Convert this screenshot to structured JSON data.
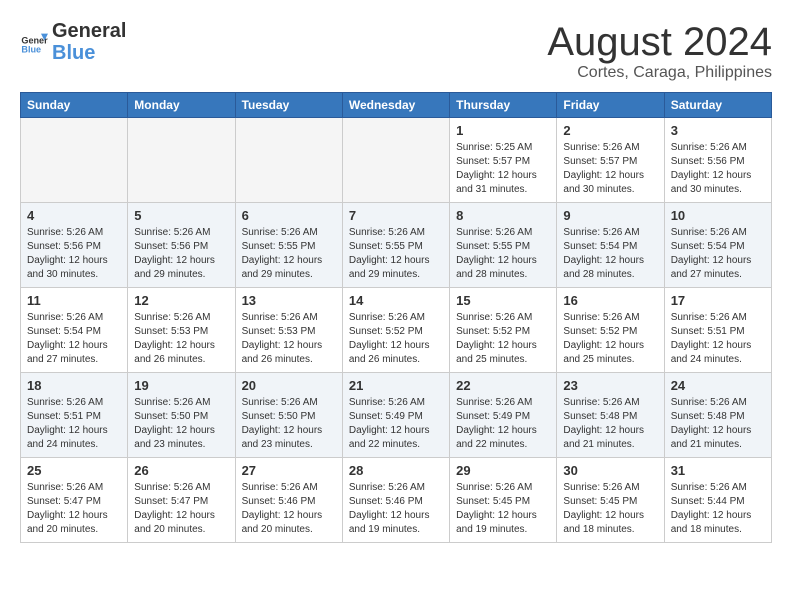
{
  "header": {
    "logo_line1": "General",
    "logo_line2": "Blue",
    "month_year": "August 2024",
    "location": "Cortes, Caraga, Philippines"
  },
  "weekdays": [
    "Sunday",
    "Monday",
    "Tuesday",
    "Wednesday",
    "Thursday",
    "Friday",
    "Saturday"
  ],
  "weeks": [
    [
      {
        "day": "",
        "info": ""
      },
      {
        "day": "",
        "info": ""
      },
      {
        "day": "",
        "info": ""
      },
      {
        "day": "",
        "info": ""
      },
      {
        "day": "1",
        "info": "Sunrise: 5:25 AM\nSunset: 5:57 PM\nDaylight: 12 hours\nand 31 minutes."
      },
      {
        "day": "2",
        "info": "Sunrise: 5:26 AM\nSunset: 5:57 PM\nDaylight: 12 hours\nand 30 minutes."
      },
      {
        "day": "3",
        "info": "Sunrise: 5:26 AM\nSunset: 5:56 PM\nDaylight: 12 hours\nand 30 minutes."
      }
    ],
    [
      {
        "day": "4",
        "info": "Sunrise: 5:26 AM\nSunset: 5:56 PM\nDaylight: 12 hours\nand 30 minutes."
      },
      {
        "day": "5",
        "info": "Sunrise: 5:26 AM\nSunset: 5:56 PM\nDaylight: 12 hours\nand 29 minutes."
      },
      {
        "day": "6",
        "info": "Sunrise: 5:26 AM\nSunset: 5:55 PM\nDaylight: 12 hours\nand 29 minutes."
      },
      {
        "day": "7",
        "info": "Sunrise: 5:26 AM\nSunset: 5:55 PM\nDaylight: 12 hours\nand 29 minutes."
      },
      {
        "day": "8",
        "info": "Sunrise: 5:26 AM\nSunset: 5:55 PM\nDaylight: 12 hours\nand 28 minutes."
      },
      {
        "day": "9",
        "info": "Sunrise: 5:26 AM\nSunset: 5:54 PM\nDaylight: 12 hours\nand 28 minutes."
      },
      {
        "day": "10",
        "info": "Sunrise: 5:26 AM\nSunset: 5:54 PM\nDaylight: 12 hours\nand 27 minutes."
      }
    ],
    [
      {
        "day": "11",
        "info": "Sunrise: 5:26 AM\nSunset: 5:54 PM\nDaylight: 12 hours\nand 27 minutes."
      },
      {
        "day": "12",
        "info": "Sunrise: 5:26 AM\nSunset: 5:53 PM\nDaylight: 12 hours\nand 26 minutes."
      },
      {
        "day": "13",
        "info": "Sunrise: 5:26 AM\nSunset: 5:53 PM\nDaylight: 12 hours\nand 26 minutes."
      },
      {
        "day": "14",
        "info": "Sunrise: 5:26 AM\nSunset: 5:52 PM\nDaylight: 12 hours\nand 26 minutes."
      },
      {
        "day": "15",
        "info": "Sunrise: 5:26 AM\nSunset: 5:52 PM\nDaylight: 12 hours\nand 25 minutes."
      },
      {
        "day": "16",
        "info": "Sunrise: 5:26 AM\nSunset: 5:52 PM\nDaylight: 12 hours\nand 25 minutes."
      },
      {
        "day": "17",
        "info": "Sunrise: 5:26 AM\nSunset: 5:51 PM\nDaylight: 12 hours\nand 24 minutes."
      }
    ],
    [
      {
        "day": "18",
        "info": "Sunrise: 5:26 AM\nSunset: 5:51 PM\nDaylight: 12 hours\nand 24 minutes."
      },
      {
        "day": "19",
        "info": "Sunrise: 5:26 AM\nSunset: 5:50 PM\nDaylight: 12 hours\nand 23 minutes."
      },
      {
        "day": "20",
        "info": "Sunrise: 5:26 AM\nSunset: 5:50 PM\nDaylight: 12 hours\nand 23 minutes."
      },
      {
        "day": "21",
        "info": "Sunrise: 5:26 AM\nSunset: 5:49 PM\nDaylight: 12 hours\nand 22 minutes."
      },
      {
        "day": "22",
        "info": "Sunrise: 5:26 AM\nSunset: 5:49 PM\nDaylight: 12 hours\nand 22 minutes."
      },
      {
        "day": "23",
        "info": "Sunrise: 5:26 AM\nSunset: 5:48 PM\nDaylight: 12 hours\nand 21 minutes."
      },
      {
        "day": "24",
        "info": "Sunrise: 5:26 AM\nSunset: 5:48 PM\nDaylight: 12 hours\nand 21 minutes."
      }
    ],
    [
      {
        "day": "25",
        "info": "Sunrise: 5:26 AM\nSunset: 5:47 PM\nDaylight: 12 hours\nand 20 minutes."
      },
      {
        "day": "26",
        "info": "Sunrise: 5:26 AM\nSunset: 5:47 PM\nDaylight: 12 hours\nand 20 minutes."
      },
      {
        "day": "27",
        "info": "Sunrise: 5:26 AM\nSunset: 5:46 PM\nDaylight: 12 hours\nand 20 minutes."
      },
      {
        "day": "28",
        "info": "Sunrise: 5:26 AM\nSunset: 5:46 PM\nDaylight: 12 hours\nand 19 minutes."
      },
      {
        "day": "29",
        "info": "Sunrise: 5:26 AM\nSunset: 5:45 PM\nDaylight: 12 hours\nand 19 minutes."
      },
      {
        "day": "30",
        "info": "Sunrise: 5:26 AM\nSunset: 5:45 PM\nDaylight: 12 hours\nand 18 minutes."
      },
      {
        "day": "31",
        "info": "Sunrise: 5:26 AM\nSunset: 5:44 PM\nDaylight: 12 hours\nand 18 minutes."
      }
    ]
  ]
}
